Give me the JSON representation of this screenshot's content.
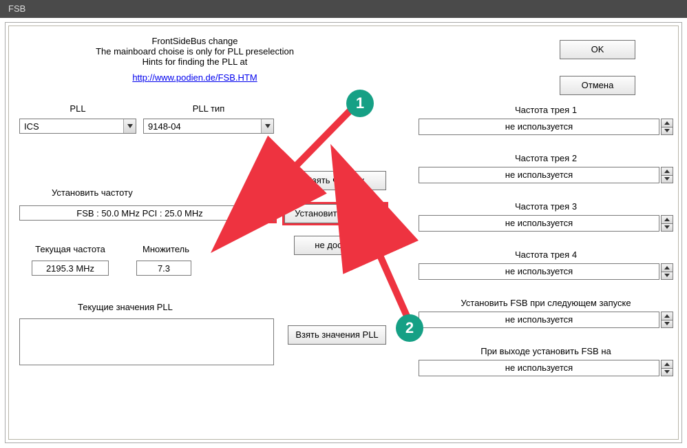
{
  "window": {
    "title": "FSB"
  },
  "header": {
    "line1": "FrontSideBus change",
    "line2": "The mainboard choise is only for PLL preselection",
    "line3": "Hints for finding the PLL at",
    "link": "http://www.podien.de/FSB.HTM"
  },
  "labels": {
    "pll": "PLL",
    "pll_type": "PLL тип",
    "set_freq_label": "Установить частоту",
    "current_freq": "Текущая частота",
    "multiplier": "Множитель",
    "current_pll": "Текущие значения PLL"
  },
  "values": {
    "pll": "ICS",
    "pll_type": "9148-04",
    "fsb_line": "FSB :  50.0 MHz  PCI :  25.0 MHz",
    "current_freq": "2195.3 MHz",
    "multiplier": "7.3"
  },
  "buttons": {
    "ok": "OK",
    "cancel": "Отмена",
    "take_freq": "Взять частоту",
    "set_freq": "Установить частоту",
    "not_avail": "не доступно",
    "take_pll": "Взять значения PLL"
  },
  "trays": {
    "t1_label": "Частота трея 1",
    "t2_label": "Частота трея 2",
    "t3_label": "Частота трея 3",
    "t4_label": "Частота трея 4",
    "boot_label": "Установить FSB при следующем запуске",
    "exit_label": "При выходе установить FSB на",
    "unused": "не используется"
  },
  "annotations": {
    "one": "1",
    "two": "2"
  }
}
